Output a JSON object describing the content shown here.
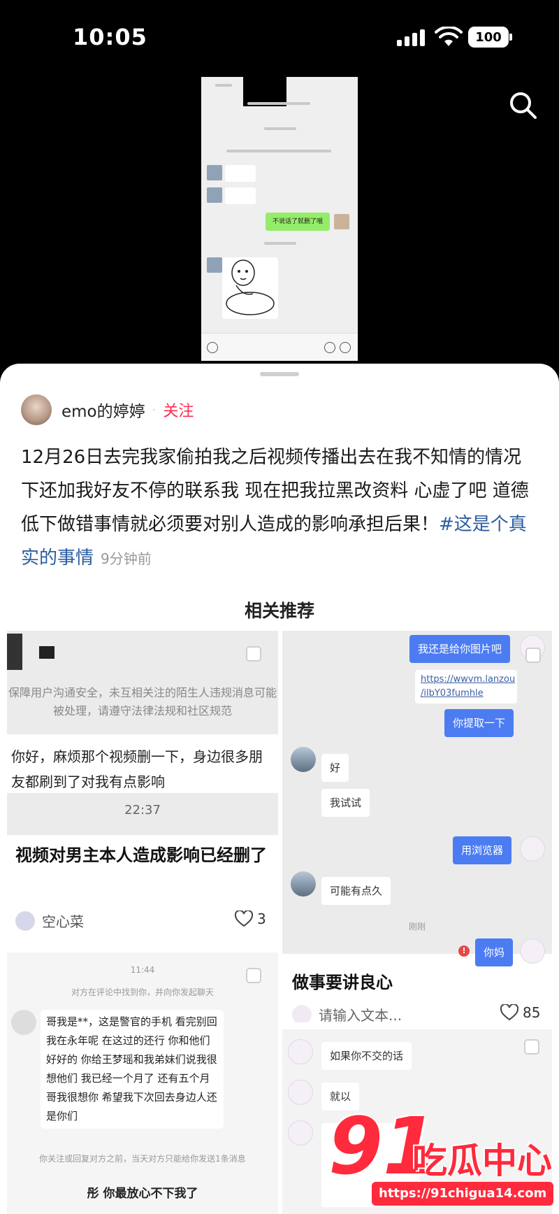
{
  "status": {
    "time": "10:05",
    "battery": "100"
  },
  "media": {
    "bubble_1": "不说话了就删了哦",
    "icons": [
      "voice-icon",
      "emoji-icon",
      "plus-icon"
    ]
  },
  "post": {
    "author": "emo的婷婷",
    "follow_label": "关注",
    "text": "12月26日去完我家偷拍我之后视频传播出去在我不知情的情况下还加我好友不停的联系我 现在把我拉黑改资料 心虚了吧 道德低下做错事情就必须要对别人造成的影响承担后果！",
    "hashtag": "#这是个真实的事情",
    "time_ago": "9分钟前"
  },
  "related_title": "相关推荐",
  "cards": [
    {
      "notice": "保障用户沟通安全，未互相关注的陌生人违规消息可能被处理，请遵守法律法规和社区规范",
      "message": "你好，麻烦那个视频删一下，身边很多朋友都刷到了对我有点影响",
      "timestamp": "22:37",
      "title": "视频对男主本人造成影响已经删了",
      "user": "空心菜",
      "likes": "3"
    },
    {
      "messages": {
        "m1": "我还是给你图片吧",
        "link": "https://wwvm.lanzou\n/ilbY03fumhle",
        "m2": "你提取一下",
        "r1": "好",
        "r2": "我试试",
        "m3": "用浏览器",
        "r3": "可能有点久",
        "divider": "刚刚",
        "m4": "你妈"
      },
      "title": "做事要讲良心",
      "user": "请输入文本...",
      "likes": "85"
    },
    {
      "timestamp": "11:44",
      "subnote": "对方在评论中找到你，并向你发起聊天",
      "message": "哥我是**，这是警官的手机 看完别回 我在永年呢 在这过的还行 你和他们好好的 你给王梦瑶和我弟妹们说我很想他们 我已经一个月了 还有五个月 哥我很想你 希望我下次回去身边人还是你们",
      "footnote": "你关注或回复对方之前，当天对方只能给你发送1条消息",
      "title": "彤 你最放心不下我了"
    },
    {
      "message_1": "如果你不交的话",
      "message_2": "就以"
    }
  ],
  "watermark": {
    "brand_num": "91",
    "brand_name": "吃瓜中心",
    "url": "https://91chigua14.com"
  }
}
